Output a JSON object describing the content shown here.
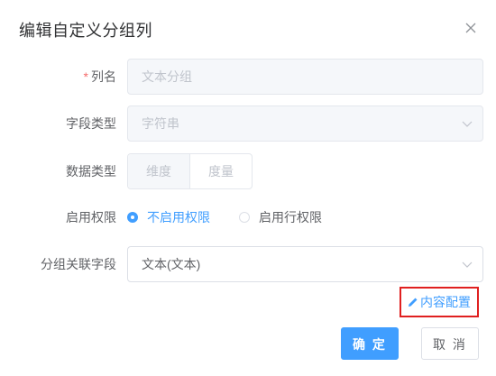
{
  "dialog": {
    "title": "编辑自定义分组列",
    "close_icon": "close-icon"
  },
  "form": {
    "column_name": {
      "label": "列名",
      "required_mark": "*",
      "placeholder": "文本分组"
    },
    "field_type": {
      "label": "字段类型",
      "value": "字符串"
    },
    "data_type": {
      "label": "数据类型",
      "options": [
        "维度",
        "度量"
      ]
    },
    "permission": {
      "label": "启用权限",
      "options": [
        "不启用权限",
        "启用行权限"
      ],
      "selected": "不启用权限"
    },
    "group_field": {
      "label": "分组关联字段",
      "value": "文本(文本)"
    }
  },
  "content_config": {
    "label": "内容配置",
    "icon": "pencil-icon"
  },
  "footer": {
    "confirm_label": "确 定",
    "cancel_label": "取 消"
  },
  "colors": {
    "primary": "#409eff",
    "highlight_border": "#e02020",
    "required": "#f56c6c"
  }
}
